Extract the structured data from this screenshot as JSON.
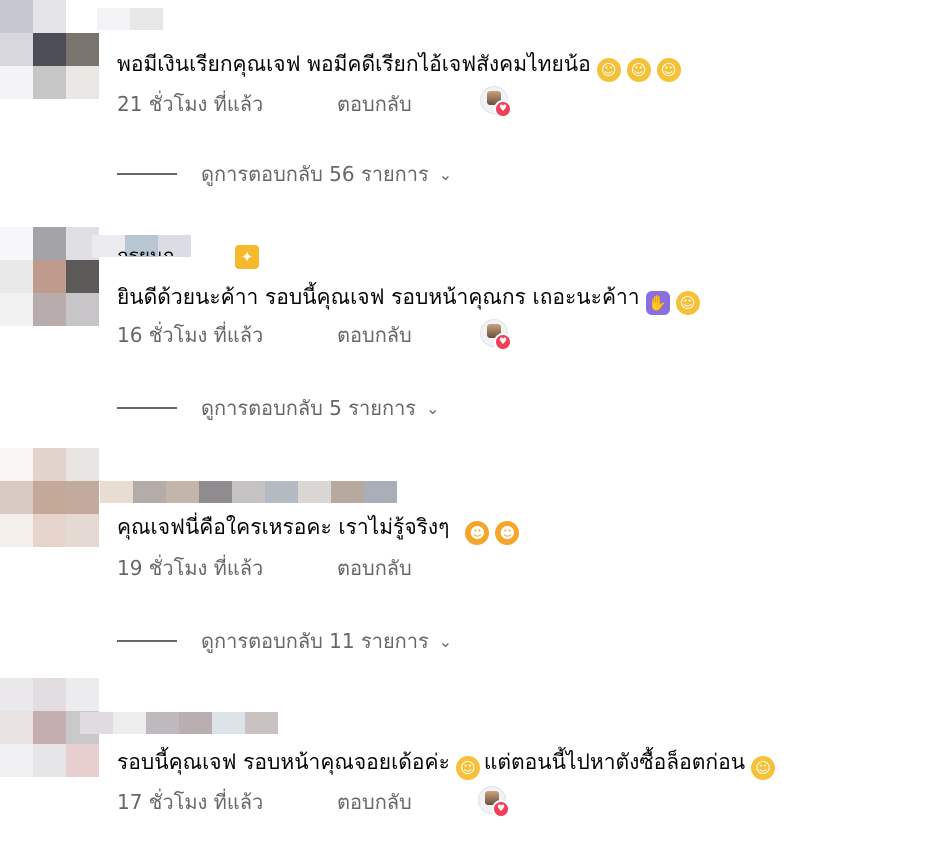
{
  "comments": [
    {
      "text": "พอมีเงินเรียกคุณเจฟ พอมีคดีเรียกไอ้เจฟสังคมไทยน้อ",
      "emojis": [
        "smiling-face-with-hearts",
        "smiling-face-with-hearts",
        "smiling-face-with-hearts"
      ],
      "time": "21 ชั่วโมง ที่แล้ว",
      "reply": "ตอบกลับ",
      "replies": "ดูการตอบกลับ 56 รายการ"
    },
    {
      "name_fragment": "กรยนก . .",
      "text": "ยินดีด้วยนะค้าา รอบนี้คุณเจฟ รอบหน้าคุณกร เถอะนะค้าา",
      "emojis": [
        "folded-hands",
        "smiling-face-with-hearts"
      ],
      "time": "16 ชั่วโมง ที่แล้ว",
      "reply": "ตอบกลับ",
      "replies": "ดูการตอบกลับ 5 รายการ"
    },
    {
      "text": "คุณเจฟนี่คือใครเหรอคะ เราไม่รู้จริงๆ",
      "emojis": [
        "grinning-face-with-sweat",
        "grinning-face-with-sweat"
      ],
      "time": "19 ชั่วโมง ที่แล้ว",
      "reply": "ตอบกลับ",
      "replies": "ดูการตอบกลับ 11 รายการ"
    },
    {
      "text_before": "รอบนี้คุณเจฟ รอบหน้าคุณจอยเด้อค่ะ",
      "text_middle": "แต่ตอนนี้ไปหาตังซื้อล็อตก่อน",
      "emojis": [
        "beaming-face",
        "face-with-tears-of-joy"
      ],
      "time": "17 ชั่วโมง ที่แล้ว",
      "reply": "ตอบกลับ"
    }
  ],
  "icons": {
    "reaction": "heart-reaction-icon",
    "chevron": "chevron-down-icon"
  },
  "colors": {
    "text": "#050505",
    "meta": "#65676b",
    "heart": "#f33e58"
  }
}
